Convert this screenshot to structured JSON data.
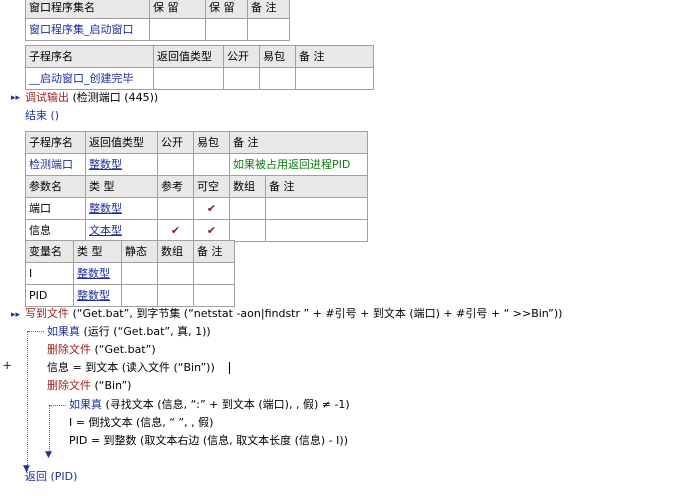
{
  "table_module": {
    "headers": [
      "窗口程序集名",
      "保 留",
      "保 留",
      "备 注"
    ],
    "row": [
      "窗口程序集_启动窗口",
      "",
      "",
      ""
    ]
  },
  "table_sub1": {
    "headers": [
      "子程序名",
      "返回值类型",
      "公开",
      "易包",
      "备 注"
    ],
    "row": [
      "__启动窗口_创建完毕",
      "",
      "",
      "",
      ""
    ]
  },
  "code_block1": {
    "line1_func": "调试输出",
    "line1_args": " (检测端口 (445))",
    "line2": "结束 ()"
  },
  "table_sub2": {
    "headers": [
      "子程序名",
      "返回值类型",
      "公开",
      "易包",
      "备 注"
    ],
    "row": [
      "检测端口",
      "整数型",
      "",
      "",
      "如果被占用返回进程PID"
    ],
    "param_headers": [
      "参数名",
      "类 型",
      "参考",
      "可空",
      "数组",
      "备 注"
    ],
    "params": [
      {
        "name": "端口",
        "type": "整数型",
        "ref": "",
        "nullable": "✔",
        "array": "",
        "note": ""
      },
      {
        "name": "信息",
        "type": "文本型",
        "ref": "✔",
        "nullable": "✔",
        "array": "",
        "note": ""
      }
    ]
  },
  "table_vars": {
    "headers": [
      "变量名",
      "类 型",
      "静态",
      "数组",
      "备 注"
    ],
    "rows": [
      {
        "name": "I",
        "type": "整数型"
      },
      {
        "name": "PID",
        "type": "整数型"
      }
    ]
  },
  "code_block2": {
    "write_func": "写到文件",
    "write_args": " (“Get.bat”, 到字节集 (“netstat -aon|findstr ” + #引号 + 到文本 (端口) + #引号 + “ >>Bin”))",
    "if1_func": "如果真",
    "if1_args": " (运行 (“Get.bat”, 真, 1))",
    "del1_func": "删除文件",
    "del1_args": " (“Get.bat”)",
    "info_line": "信息 = 到文本 (读入文件 (“Bin”))",
    "del2_func": "删除文件",
    "del2_args": " (“Bin”)",
    "if2_func": "如果真",
    "if2_args": " (寻找文本 (信息, “:” + 到文本 (端口), , 假) ≠ -1)",
    "i_line": "I = 倒找文本 (信息, “ ”, , 假)",
    "pid_line": "PID = 到整数 (取文本右边 (信息, 取文本长度 (信息) - I))",
    "return_line": "返回 (PID)",
    "plus": "+"
  }
}
